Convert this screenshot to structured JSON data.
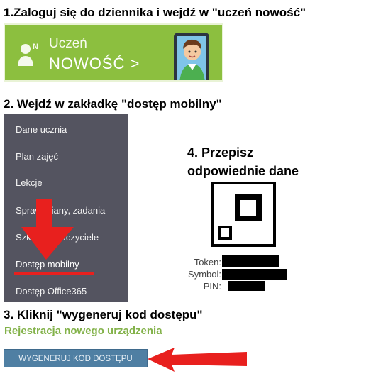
{
  "steps": {
    "step1": "1.Zaloguj się do dziennika i wejdź w \"uczeń nowość\"",
    "step2": "2. Wejdź w zakładkę \"dostęp mobilny\"",
    "step3": "3. Kliknij \"wygeneruj kod dostępu\"",
    "step4_line1": "4. Przepisz",
    "step4_line2": "odpowiednie dane"
  },
  "banner": {
    "title": "Uczeń",
    "subtitle": "NOWOŚĆ >",
    "bg_color": "#8cbf3f",
    "person_icon": "user-new-icon"
  },
  "menu": {
    "items": [
      {
        "label": "Dane ucznia"
      },
      {
        "label": "Plan zajęć"
      },
      {
        "label": "Lekcje"
      },
      {
        "label": "Sprawdziany, zadania"
      },
      {
        "label": "Szkoła i nauczyciele"
      },
      {
        "label": "Dostęp mobilny",
        "active": true
      },
      {
        "label": "Dostęp Office365"
      }
    ],
    "bg_color": "#545460"
  },
  "token_panel": {
    "token_label": "Token:",
    "symbol_label": "Symbol:",
    "pin_label": "PIN:"
  },
  "registration": {
    "title": "Rejestracja nowego urządzenia",
    "button_label": "WYGENERUJ KOD DOSTĘPU"
  },
  "annotation_color": "#e8201e"
}
